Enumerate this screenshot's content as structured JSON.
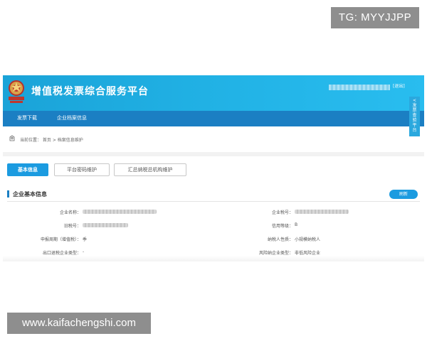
{
  "watermark": {
    "top": "TG: MYYJJPP",
    "bottom": "www.kaifachengshi.com"
  },
  "colors": {
    "header_start": "#1aa3d8",
    "header_end": "#29bdef",
    "navbar": "#1b7fc3",
    "accent": "#1b9be0"
  },
  "header": {
    "emblem_icon": "tax-emblem-icon",
    "title": "增值税发票综合服务平台",
    "logout": "[退出]"
  },
  "nav": {
    "items": [
      {
        "label": "发票下载"
      },
      {
        "label": "企业档案信息"
      }
    ]
  },
  "side_tab": {
    "label": "< 发票查验平台"
  },
  "breadcrumb": {
    "icon": "location-icon",
    "text": "当前位置： 首页 > 档案信息维护"
  },
  "tabs": [
    {
      "label": "基本信息",
      "active": true
    },
    {
      "label": "平台密码维护",
      "active": false
    },
    {
      "label": "汇总纳税总机构维护",
      "active": false
    }
  ],
  "section": {
    "title": "企业基本信息",
    "refresh_label": "刷新"
  },
  "fields": {
    "left": [
      {
        "label": "企业名称：",
        "value": ""
      },
      {
        "label": "旧税号：",
        "value": ""
      },
      {
        "label": "申报周期（增值税）：",
        "value": "季"
      },
      {
        "label": "出口退税企业类型：",
        "value": "-"
      }
    ],
    "right": [
      {
        "label": "企业税号：",
        "value": ""
      },
      {
        "label": "信用等级：",
        "value": "B"
      },
      {
        "label": "纳税人性质：",
        "value": "小规模纳税人"
      },
      {
        "label": "风险纳企业类型：",
        "value": "非低风险企业"
      }
    ]
  }
}
